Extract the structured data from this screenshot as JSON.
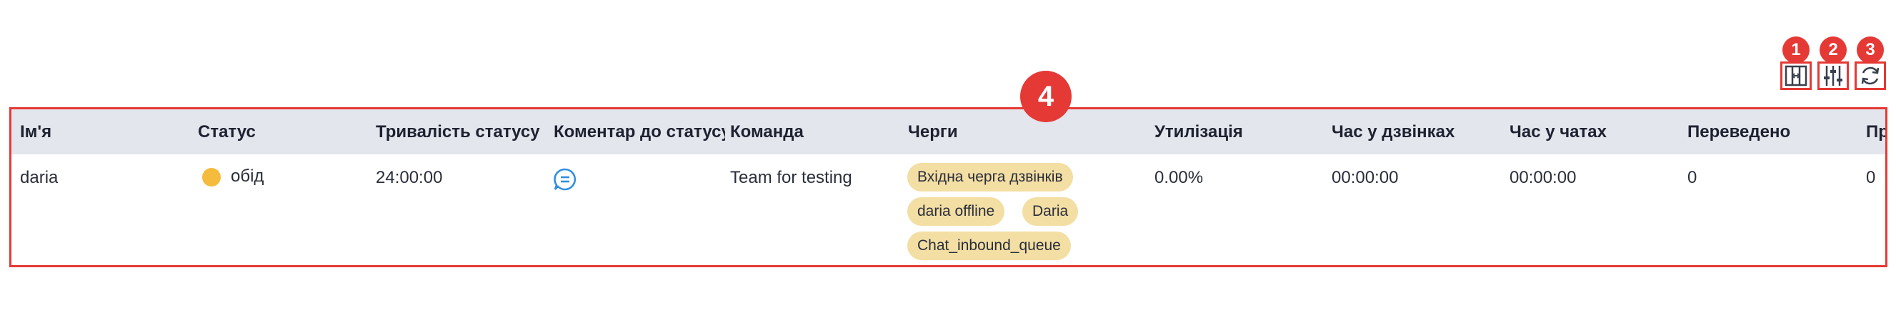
{
  "toolbar": {
    "buttons": [
      {
        "callout": "1",
        "icon": "expand-columns-icon"
      },
      {
        "callout": "2",
        "icon": "sliders-icon"
      },
      {
        "callout": "3",
        "icon": "refresh-icon"
      }
    ]
  },
  "table_callout": "4",
  "table": {
    "headers": [
      "Ім'я",
      "Статус",
      "Тривалість статусу",
      "Коментар до статусу",
      "Команда",
      "Черги",
      "Утилізація",
      "Час у дзвінках",
      "Час у чатах",
      "Переведено",
      "Пр"
    ],
    "row": {
      "name": "daria",
      "status": "обід",
      "status_color": "#f5bb3c",
      "duration": "24:00:00",
      "comment_icon": "chat-bubble-icon",
      "team": "Team for testing",
      "queues": [
        "Вхідна черга дзвінків",
        "daria offline",
        "Daria",
        "Chat_inbound_queue"
      ],
      "utilization": "0.00%",
      "call_time": "00:00:00",
      "chat_time": "00:00:00",
      "transferred": "0",
      "last": "0"
    }
  },
  "colors": {
    "accent": "#e53935",
    "header_bg": "#e4e6ee",
    "chip_bg": "#f3dea4",
    "icon_blue": "#2f8fe0"
  }
}
